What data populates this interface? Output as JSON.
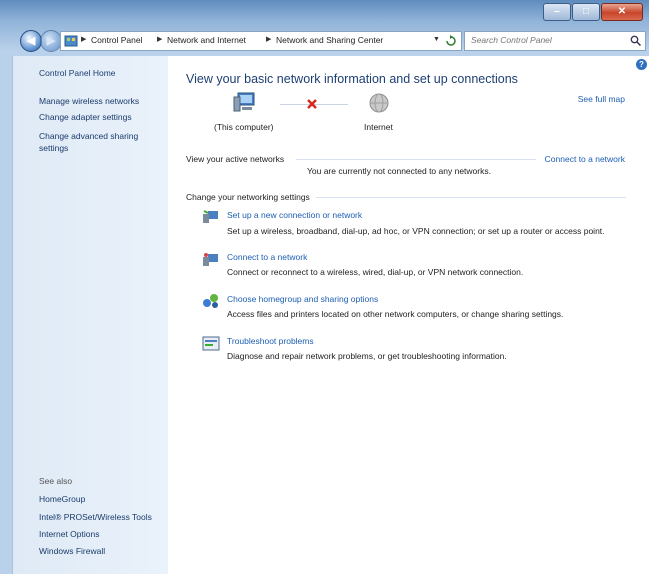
{
  "window": {
    "minimize_icon": "minimize-icon",
    "maximize_icon": "maximize-icon",
    "close_icon": "close-icon"
  },
  "breadcrumb": {
    "items": [
      "Control Panel",
      "Network and Internet",
      "Network and Sharing Center"
    ]
  },
  "search": {
    "placeholder": "Search Control Panel"
  },
  "sidebar": {
    "home": "Control Panel Home",
    "items": [
      "Manage wireless networks",
      "Change adapter settings",
      "Change advanced sharing settings"
    ],
    "see_also_label": "See also",
    "see_also": [
      "HomeGroup",
      "Intel® PROSet/Wireless Tools",
      "Internet Options",
      "Windows Firewall"
    ]
  },
  "main": {
    "title": "View your basic network information and set up connections",
    "see_full_map": "See full map",
    "map": {
      "computer_label": "(This computer)",
      "internet_label": "Internet"
    },
    "active_networks_label": "View your active networks",
    "connect_link": "Connect to a network",
    "not_connected": "You are currently not connected to any networks.",
    "settings_label": "Change your networking settings",
    "tasks": [
      {
        "title": "Set up a new connection or network",
        "desc": "Set up a wireless, broadband, dial-up, ad hoc, or VPN connection; or set up a router or access point.",
        "icon": "new-connection-icon"
      },
      {
        "title": "Connect to a network",
        "desc": "Connect or reconnect to a wireless, wired, dial-up, or VPN network connection.",
        "icon": "connect-network-icon"
      },
      {
        "title": "Choose homegroup and sharing options",
        "desc": "Access files and printers located on other network computers, or change sharing settings.",
        "icon": "homegroup-icon"
      },
      {
        "title": "Troubleshoot problems",
        "desc": "Diagnose and repair network problems, or get troubleshooting information.",
        "icon": "troubleshoot-icon"
      }
    ]
  }
}
